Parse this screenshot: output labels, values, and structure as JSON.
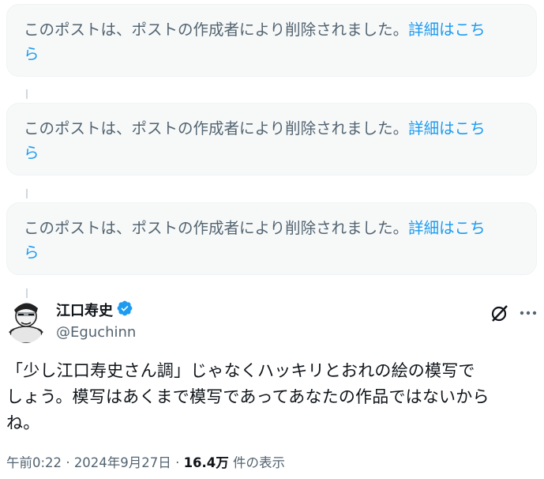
{
  "deleted_posts": [
    {
      "message": "このポストは、ポストの作成者により削除されました。",
      "link_a": "詳細はこち",
      "link_b": "ら"
    },
    {
      "message": "このポストは、ポストの作成者により削除されました。",
      "link_a": "詳細はこち",
      "link_b": "ら"
    },
    {
      "message": "このポストは、ポストの作成者により削除されました。",
      "link_a": "詳細はこち",
      "link_b": "ら"
    }
  ],
  "post": {
    "author_name": "江口寿史",
    "author_handle": "@Eguchinn",
    "verified": true,
    "text_lines": [
      "「少し江口寿史さん調」じゃなくハッキリとおれの絵の模写で",
      "しょう。模写はあくまで模写であってあなたの作品ではないから",
      "ね。"
    ],
    "time": "午前0:22",
    "date": "2024年9月27日",
    "sep": "·",
    "views_count": "16.4万",
    "views_label": "件の表示"
  },
  "icons": {
    "verified_badge": "verified-badge-icon",
    "grok": "grok-icon",
    "more": "more-icon"
  },
  "colors": {
    "link": "#1d9bf0",
    "muted": "#536471",
    "text": "#0f1419",
    "card_bg": "#f7f9f9"
  }
}
